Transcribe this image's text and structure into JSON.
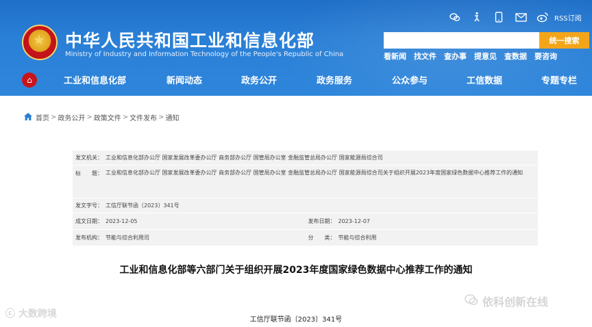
{
  "header": {
    "title_cn": "中华人民共和国工业和信息化部",
    "title_en": "Ministry of Industry and Information Technology of the People's Republic of China",
    "top_icons": [
      "wechat-icon",
      "accessibility-icon",
      "mobile-icon",
      "mail-icon",
      "weibo-icon"
    ],
    "rss_label": "RSS订阅",
    "search": {
      "placeholder": "",
      "button": "统一搜索"
    },
    "quick_links": [
      "看新闻",
      "找文件",
      "查办事",
      "提意见",
      "查数据",
      "要咨询"
    ]
  },
  "nav": {
    "items": [
      "工业和信息化部",
      "新闻动态",
      "政务公开",
      "政务服务",
      "公众参与",
      "工信数据",
      "专题专栏"
    ]
  },
  "breadcrumb": [
    "首页",
    "政务公开",
    "政策文件",
    "文件发布",
    "通知"
  ],
  "doc_info": {
    "issuer_label": "发文机关：",
    "issuer": "工业和信息化部办公厅 国家发展改革委办公厅 商务部办公厅 国管局办公室 金融监管总局办公厅 国家能源局综合司",
    "title_label": "标　　题：",
    "title": "工业和信息化部办公厅 国家发展改革委办公厅 商务部办公厅 国管局办公室 金融监管总局办公厅 国家能源局综合司关于组织开展2023年度国家绿色数据中心推荐工作的通知",
    "docno_label": "发文字号：",
    "docno": "工信厅联节函〔2023〕341号",
    "written_label": "成文日期：",
    "written": "2023-12-05",
    "published_label": "发布日期：",
    "published": "2023-12-07",
    "org_label": "发布机构：",
    "org": "节能与综合利用司",
    "category_label": "分　　类：",
    "category": "节能与综合利用"
  },
  "document": {
    "heading": "工业和信息化部等六部门关于组织开展2023年度国家绿色数据中心推荐工作的通知",
    "number": "工信厅联节函〔2023〕341号"
  },
  "watermarks": {
    "left": "大数跨境",
    "right": "依科创新在线"
  },
  "colors": {
    "header_blue": "#2a7fd6",
    "search_button": "#f3a51a",
    "emblem_red": "#c8141b"
  }
}
